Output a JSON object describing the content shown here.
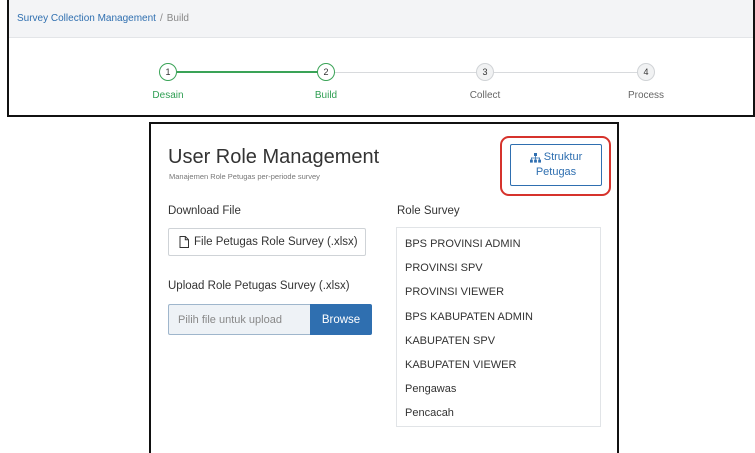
{
  "breadcrumb": {
    "link": "Survey Collection Management",
    "separator": "/",
    "current": "Build"
  },
  "stepper": {
    "steps": [
      {
        "number": "1",
        "label": "Desain",
        "state": "done"
      },
      {
        "number": "2",
        "label": "Build",
        "state": "current"
      },
      {
        "number": "3",
        "label": "Collect",
        "state": "todo"
      },
      {
        "number": "4",
        "label": "Process",
        "state": "todo"
      }
    ]
  },
  "card": {
    "title": "User Role Management",
    "subtitle": "Manajemen Role Petugas per-periode survey",
    "struktur_button": {
      "line1": "Struktur",
      "line2": "Petugas",
      "icon": "sitemap-icon"
    },
    "download": {
      "label": "Download File",
      "button_label": "File Petugas Role Survey (.xlsx)",
      "icon": "file-icon"
    },
    "upload": {
      "label": "Upload Role Petugas Survey (.xlsx)",
      "placeholder": "Pilih file untuk upload",
      "browse_label": "Browse"
    },
    "roles": {
      "label": "Role Survey",
      "items": [
        "BPS PROVINSI ADMIN",
        "PROVINSI SPV",
        "PROVINSI VIEWER",
        "BPS KABUPATEN ADMIN",
        "KABUPATEN SPV",
        "KABUPATEN VIEWER",
        "Pengawas",
        "Pencacah"
      ]
    }
  },
  "colors": {
    "accent": "#2f6fb0",
    "success": "#3aa357",
    "highlight": "#d6332c"
  }
}
